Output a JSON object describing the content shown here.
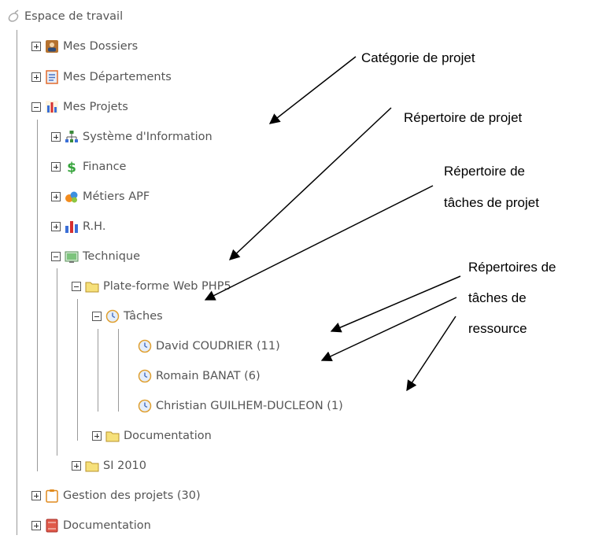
{
  "tree": {
    "root": "Espace de travail",
    "nodes": {
      "mes_dossiers": "Mes Dossiers",
      "mes_departements": "Mes Départements",
      "mes_projets": "Mes Projets",
      "systeme_information": "Système d'Information",
      "finance": "Finance",
      "metiers_apf": "Métiers APF",
      "rh": "R.H.",
      "technique": "Technique",
      "plateforme_web": "Plate-forme Web PHP5",
      "taches": "Tâches",
      "david": "David COUDRIER (11)",
      "romain": "Romain BANAT (6)",
      "christian": "Christian GUILHEM-DUCLEON (1)",
      "documentation_sub": "Documentation",
      "si_2010": "SI 2010",
      "gestion_projets": "Gestion des projets (30)",
      "documentation": "Documentation"
    }
  },
  "annotations": {
    "categorie": "Catégorie de projet",
    "repertoire": "Répertoire de projet",
    "taches_line1": "Répertoire de",
    "taches_line2": "tâches de projet",
    "ressource_line1": "Répertoires de",
    "ressource_line2": "tâches de",
    "ressource_line3": "ressource"
  },
  "icons": {
    "root": "ring-icon",
    "mes_dossiers": "person-folder-icon",
    "mes_departements": "document-list-icon",
    "mes_projets": "bar-chart-icon",
    "systeme_information": "network-icon",
    "finance": "dollar-icon",
    "metiers_apf": "bubbles-icon",
    "rh": "bar-chart-icon",
    "technique": "screen-icon",
    "folder": "folder-icon",
    "clock": "clock-icon",
    "gestion_projets": "clipboard-icon",
    "documentation": "book-icon"
  }
}
